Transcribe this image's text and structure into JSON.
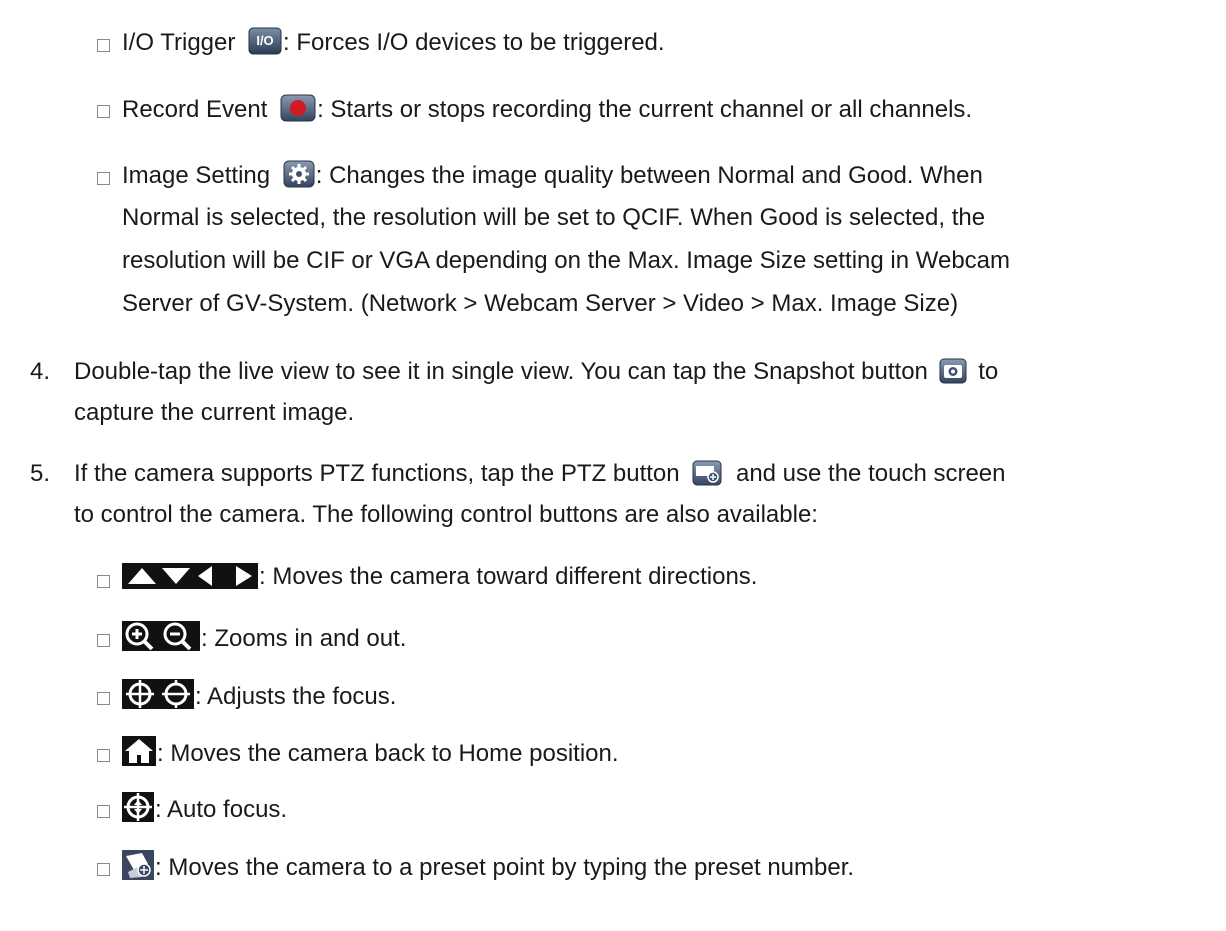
{
  "items": {
    "io_trigger": {
      "label": "I/O Trigger",
      "icon_text": "I/O",
      "desc": ": Forces I/O devices to be triggered."
    },
    "record_event": {
      "label": "Record Event",
      "desc": ": Starts or stops recording the current channel or all channels."
    },
    "image_setting": {
      "label": "Image Setting",
      "desc_line1": ": Changes the image quality between Normal and Good. When",
      "desc_line2": "Normal is selected, the resolution will be set to QCIF. When Good is selected, the",
      "desc_line3": "resolution will be CIF or VGA depending on the Max. Image Size setting in Webcam",
      "desc_line4": "Server of GV-System. (Network > Webcam Server > Video > Max. Image Size)"
    }
  },
  "step4": {
    "number": "4.",
    "text_before": "Double-tap the live view to see it in single view. You can tap the Snapshot button",
    "text_after": "to",
    "line2": "capture the current image."
  },
  "step5": {
    "number": "5.",
    "text_before": "If the camera supports PTZ functions, tap the PTZ button",
    "text_after": "and use the touch screen",
    "line2": "to control the camera. The following control buttons are also available:"
  },
  "ptz_controls": {
    "directions": ": Moves the camera toward different directions.",
    "zoom": ": Zooms in and out.",
    "focus": ": Adjusts the focus.",
    "home": ": Moves the camera back to Home position.",
    "auto_focus": ": Auto focus.",
    "preset": ": Moves the camera to a preset point by typing the preset number."
  },
  "icons": {
    "io": "io-trigger-icon",
    "record": "record-icon",
    "settings": "gear-icon",
    "snapshot": "camera-icon",
    "ptz": "ptz-icon",
    "arrows": "direction-arrows-icon",
    "zoom": "zoom-icons",
    "focus": "focus-icons",
    "home": "home-icon",
    "autofocus": "auto-focus-icon",
    "preset": "preset-icon"
  }
}
